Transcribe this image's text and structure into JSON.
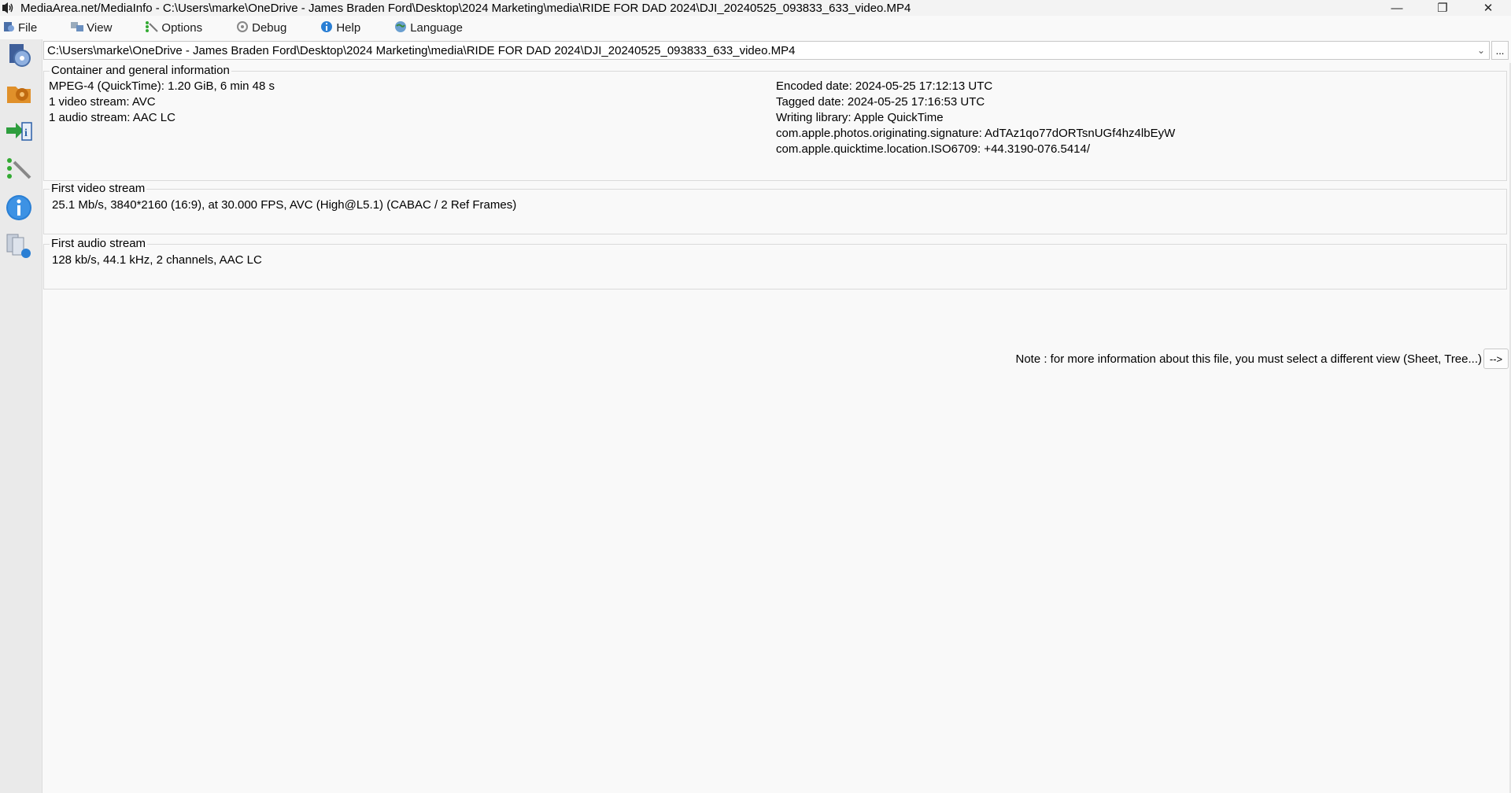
{
  "window": {
    "title": "MediaArea.net/MediaInfo - C:\\Users\\marke\\OneDrive - James Braden Ford\\Desktop\\2024 Marketing\\media\\RIDE FOR DAD 2024\\DJI_20240525_093833_633_video.MP4",
    "minimize_glyph": "—",
    "restore_glyph": "❐",
    "close_glyph": "✕"
  },
  "menu": {
    "items": [
      {
        "label": "File",
        "icon": "file-menu-icon"
      },
      {
        "label": "View",
        "icon": "view-menu-icon"
      },
      {
        "label": "Options",
        "icon": "options-menu-icon"
      },
      {
        "label": "Debug",
        "icon": "debug-menu-icon"
      },
      {
        "label": "Help",
        "icon": "help-menu-icon"
      },
      {
        "label": "Language",
        "icon": "language-menu-icon"
      }
    ]
  },
  "sidebar": {
    "buttons": [
      {
        "icon": "open-file-icon"
      },
      {
        "icon": "open-folder-icon"
      },
      {
        "icon": "export-icon"
      },
      {
        "icon": "preferences-icon"
      },
      {
        "icon": "info-icon"
      },
      {
        "icon": "about-icon"
      }
    ]
  },
  "path": {
    "value": "C:\\Users\\marke\\OneDrive - James Braden Ford\\Desktop\\2024 Marketing\\media\\RIDE FOR DAD 2024\\DJI_20240525_093833_633_video.MP4",
    "dropdown_glyph": "⌄",
    "browse_label": "..."
  },
  "general": {
    "title": "Container and general information",
    "left": [
      "MPEG-4 (QuickTime): 1.20 GiB, 6 min 48 s",
      "1 video stream: AVC",
      "1 audio stream: AAC LC"
    ],
    "right": [
      "Encoded date: 2024-05-25 17:12:13 UTC",
      "Tagged date: 2024-05-25 17:16:53 UTC",
      "Writing library: Apple QuickTime",
      "com.apple.photos.originating.signature: AdTAz1qo77dORTsnUGf4hz4lbEyW",
      "com.apple.quicktime.location.ISO6709: +44.3190-076.5414/"
    ]
  },
  "video": {
    "title": "First video stream",
    "line": "25.1 Mb/s, 3840*2160 (16:9), at 30.000 FPS, AVC (High@L5.1) (CABAC / 2 Ref Frames)"
  },
  "audio": {
    "title": "First audio stream",
    "line": "128 kb/s, 44.1 kHz, 2 channels, AAC LC"
  },
  "note": {
    "text": "Note : for more information about this file, you must select a different view (Sheet, Tree...)",
    "button_label": "-->"
  },
  "colors": {
    "background": "#f9f9f9",
    "sidebar": "#eaeaea",
    "info_blue": "#2a7fd4",
    "export_green": "#2e9e3e"
  }
}
